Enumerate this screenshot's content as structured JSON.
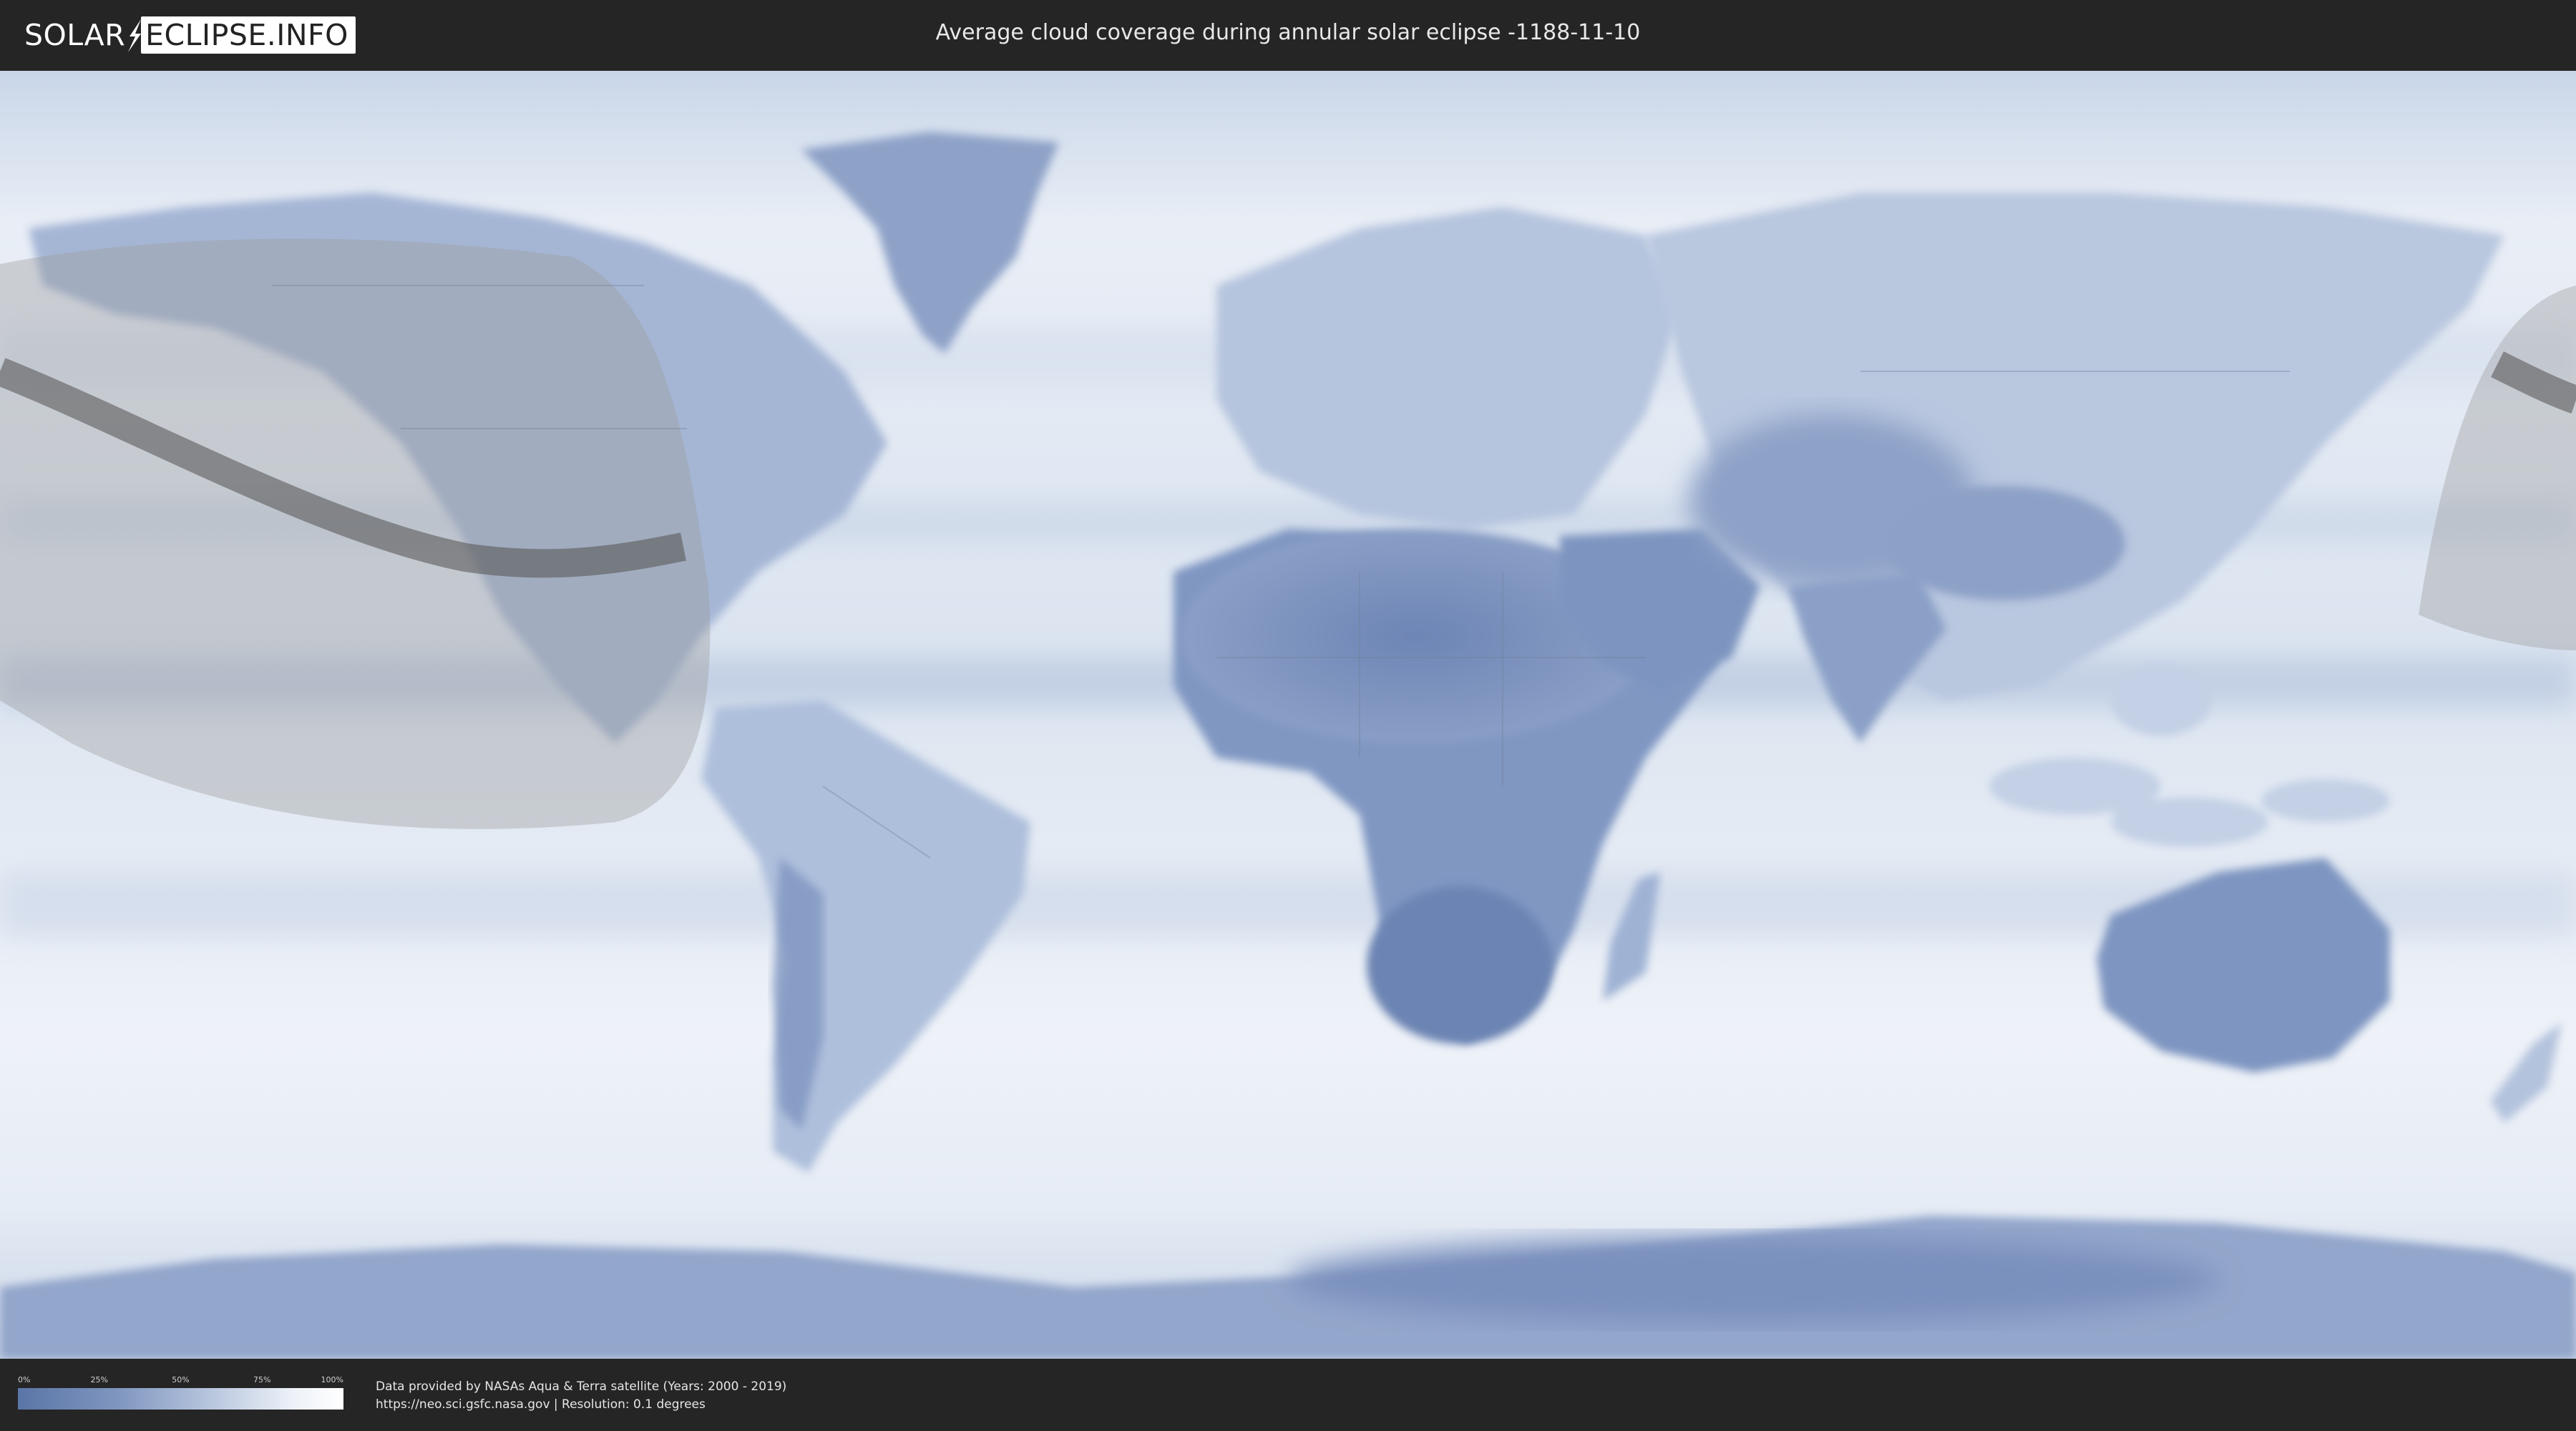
{
  "header": {
    "logo_part_a": "SOLAR",
    "logo_part_b": "ECLIPSE.INFO",
    "title": "Average cloud coverage during annular solar eclipse -1188-11-10"
  },
  "legend": {
    "ticks": [
      "0%",
      "25%",
      "50%",
      "75%",
      "100%"
    ],
    "gradient_colors": [
      "#5a75a6",
      "#7e95bf",
      "#b9c7de",
      "#eef2f8",
      "#ffffff"
    ]
  },
  "credits": {
    "line1": "Data provided by NASAs Aqua & Terra satellite (Years: 2000 - 2019)",
    "line2": "https://neo.sci.gsfc.nasa.gov | Resolution: 0.1 degrees"
  },
  "map": {
    "style": "cloud-coverage",
    "ocean_color": "#dde6f1",
    "land_color": "#8196c0",
    "low_cloud_color": "#6b83b3",
    "eclipse_shade_color": "#9a9a9a",
    "central_path_color": "#555555"
  }
}
